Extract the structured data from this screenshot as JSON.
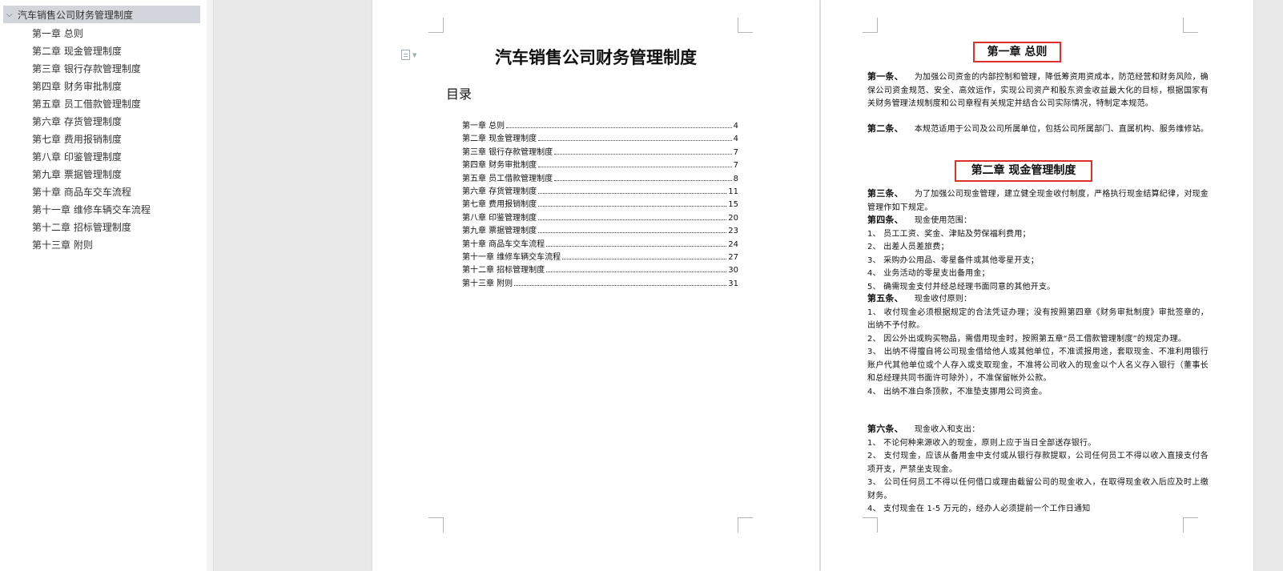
{
  "nav": {
    "root": "汽车销售公司财务管理制度",
    "items": [
      "第一章 总则",
      "第二章 现金管理制度",
      "第三章 银行存款管理制度",
      "第四章 财务审批制度",
      "第五章 员工借款管理制度",
      "第六章 存货管理制度",
      "第七章 费用报销制度",
      "第八章 印鉴管理制度",
      "第九章 票据管理制度",
      "第十章 商品车交车流程",
      "第十一章 维修车辆交车流程",
      "第十二章 招标管理制度",
      "第十三章 附则"
    ]
  },
  "page1": {
    "title": "汽车销售公司财务管理制度",
    "toc_heading": "目录",
    "toc": [
      {
        "text": "第一章 总则",
        "page": "4"
      },
      {
        "text": "第二章 现金管理制度",
        "page": "4"
      },
      {
        "text": "第三章 银行存款管理制度",
        "page": "7"
      },
      {
        "text": "第四章 财务审批制度",
        "page": "7"
      },
      {
        "text": "第五章 员工借款管理制度",
        "page": "8"
      },
      {
        "text": "第六章 存货管理制度",
        "page": "11"
      },
      {
        "text": "第七章 费用报销制度",
        "page": "15"
      },
      {
        "text": "第八章 印鉴管理制度",
        "page": "20"
      },
      {
        "text": "第九章 票据管理制度",
        "page": "23"
      },
      {
        "text": "第十章 商品车交车流程",
        "page": "24"
      },
      {
        "text": "第十一章 维修车辆交车流程",
        "page": "27"
      },
      {
        "text": "第十二章 招标管理制度",
        "page": "30"
      },
      {
        "text": "第十三章 附则",
        "page": "31"
      }
    ]
  },
  "page2": {
    "chapter1": "第一章 总则",
    "chapter2": "第二章 现金管理制度",
    "art1_label": "第一条、",
    "art1_text": "为加强公司资金的内部控制和管理，降低筹资用资成本，防范经营和财务风险，确保公司资金规范、安全、高效运作，实现公司资产和股东资金收益最大化的目标，根据国家有关财务管理法规制度和公司章程有关规定并结合公司实际情况，特制定本规范。",
    "art2_label": "第二条、",
    "art2_text": "本规范适用于公司及公司所属单位，包括公司所属部门、直属机构、服务维修站。",
    "art3_label": "第三条、",
    "art3_text": "为了加强公司现金管理，建立健全现金收付制度，严格执行现金结算纪律，对现金管理作如下规定。",
    "art4_label": "第四条、",
    "art4_text": "现金使用范围：",
    "art4_items": [
      "1、 员工工资、奖金、津贴及劳保福利费用；",
      "2、 出差人员差旅费；",
      "3、 采购办公用品、零星备件或其他零星开支；",
      "4、 业务活动的零星支出备用金；",
      "5、 确需现金支付并经总经理书面同意的其他开支。"
    ],
    "art5_label": "第五条、",
    "art5_text": "现金收付原则：",
    "art5_items": [
      "1、 收付现金必须根据规定的合法凭证办理；没有按照第四章《财务审批制度》审批签章的，出纳不予付款。",
      "2、 因公外出或购买物品，需借用现金时，按照第五章“员工借款管理制度”的规定办理。",
      "3、 出纳不得擅自将公司现金借给他人或其他单位，不准谎报用途，套取现金、不准利用银行账户代其他单位或个人存入或支取现金，不准将公司收入的现金以个人名义存入银行（董事长和总经理共同书面许可除外），不准保留帐外公款。",
      "4、 出纳不准白条顶款，不准垫支挪用公司资金。"
    ],
    "art6_label": "第六条、",
    "art6_text": "现金收入和支出：",
    "art6_items": [
      "1、 不论何种来源收入的现金，原则上应于当日全部送存银行。",
      "2、 支付现金，应该从备用金中支付或从银行存款提取，公司任何员工不得以收入直接支付各项开支，严禁坐支现金。",
      "3、 公司任何员工不得以任何借口或理由截留公司的现金收入，在取得现金收入后应及时上缴财务。",
      "4、 支付现金在 1-5 万元的，经办人必须提前一个工作日通知"
    ]
  }
}
